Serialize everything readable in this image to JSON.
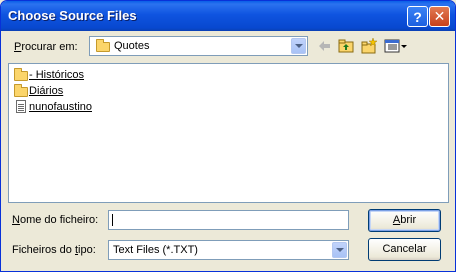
{
  "window": {
    "title": "Choose Source Files",
    "help_glyph": "?",
    "close_glyph": "✕"
  },
  "look_in": {
    "label_pre": "",
    "label_accel": "P",
    "label_post": "rocurar em:",
    "value": "Quotes"
  },
  "toolbar": {
    "icons": [
      "back-arrow-icon",
      "up-folder-icon",
      "new-folder-icon",
      "view-menu-icon"
    ]
  },
  "files": [
    {
      "name": "- Históricos",
      "type": "folder"
    },
    {
      "name": "Diários",
      "type": "folder"
    },
    {
      "name": "nunofaustino",
      "type": "file"
    }
  ],
  "filename": {
    "label_pre": "",
    "label_accel": "N",
    "label_post": "ome do ficheiro:",
    "value": ""
  },
  "filetype": {
    "label_pre": "Ficheiros do ",
    "label_accel": "t",
    "label_post": "ipo:",
    "value": "Text Files (*.TXT)"
  },
  "buttons": {
    "open_accel": "A",
    "open_rest": "brir",
    "cancel": "Cancelar"
  },
  "colors": {
    "titlebar": "#0a54e3",
    "face": "#ece9d8",
    "border": "#7f9db9"
  }
}
